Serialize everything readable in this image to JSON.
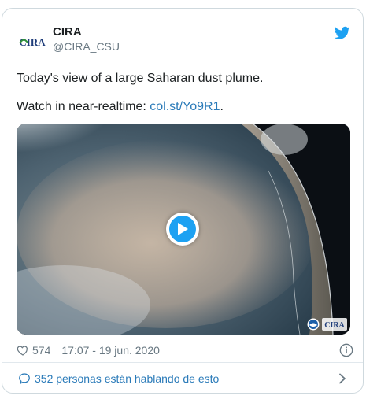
{
  "author": {
    "display_name": "CIRA",
    "handle": "@CIRA_CSU",
    "avatar_text": "CIRA"
  },
  "tweet": {
    "line1": "Today's view of a large Saharan dust plume.",
    "line2_prefix": "Watch in near-realtime: ",
    "link_text": "col.st/Yo9R1",
    "line2_suffix": "."
  },
  "media": {
    "type": "video",
    "corner_logo_text": "CIRA"
  },
  "meta": {
    "likes": "574",
    "timestamp": "17:07 - 19 jun. 2020"
  },
  "footer": {
    "conversation_text": "352 personas están hablando de esto"
  },
  "colors": {
    "brand_blue": "#1da1f2",
    "link_blue": "#2b7bb9",
    "muted": "#697882",
    "border": "#cfd9de"
  }
}
